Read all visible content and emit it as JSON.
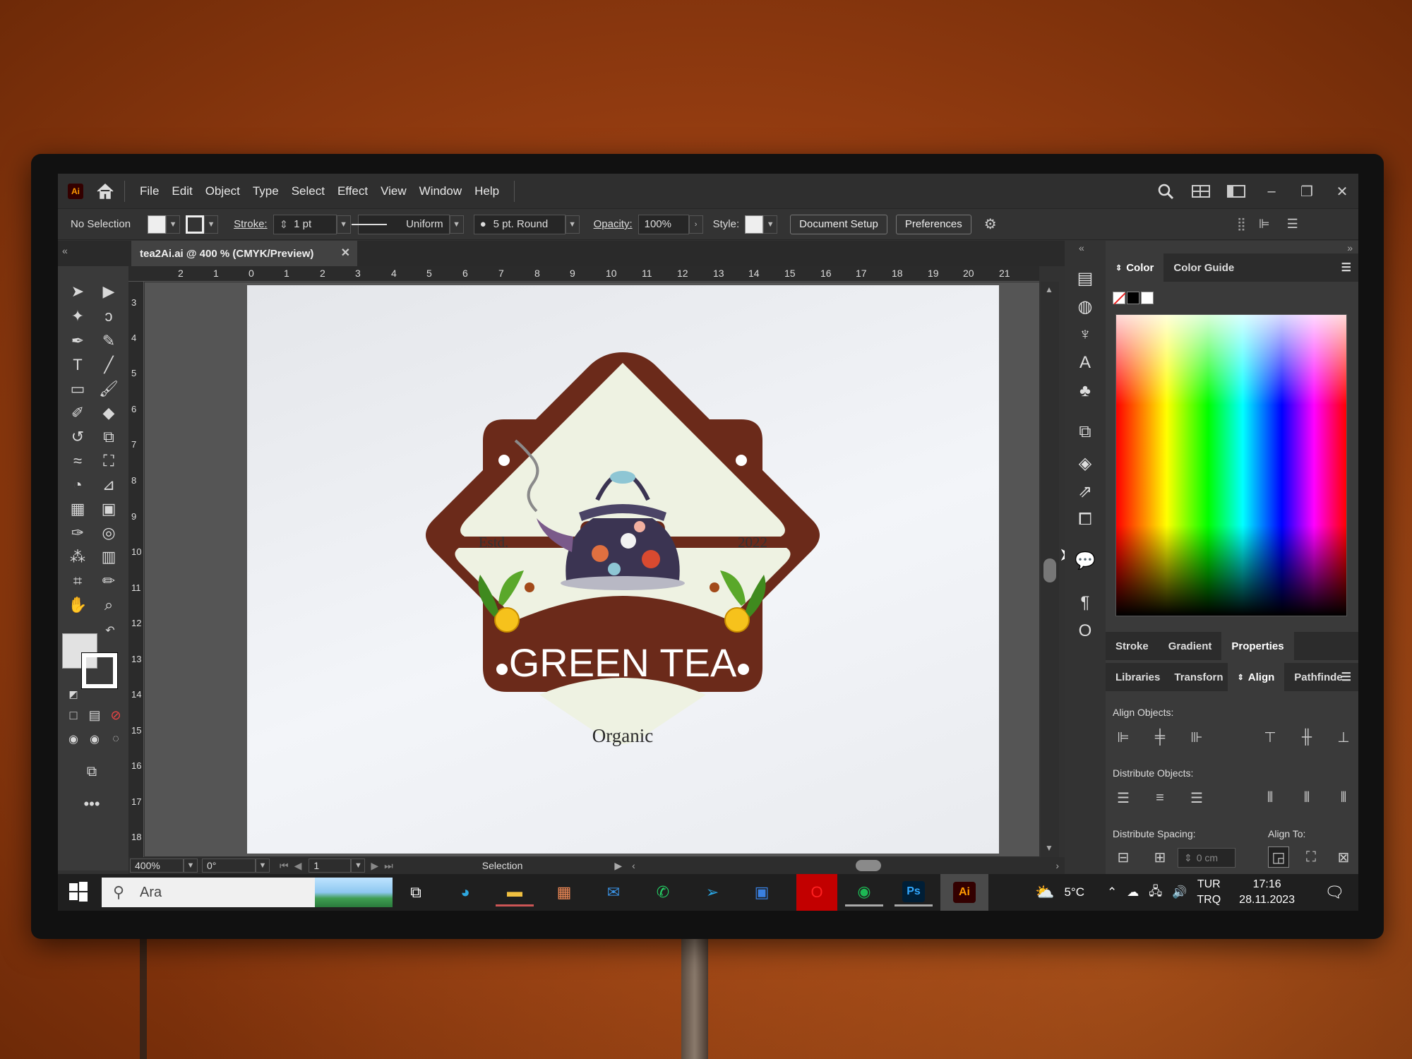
{
  "menubar": {
    "logo": "Ai",
    "items": [
      "File",
      "Edit",
      "Object",
      "Type",
      "Select",
      "Effect",
      "View",
      "Window",
      "Help"
    ]
  },
  "controlbar": {
    "selection": "No Selection",
    "stroke_label": "Stroke:",
    "stroke_weight": "1 pt",
    "profile": "Uniform",
    "brush": "5 pt. Round",
    "opacity_label": "Opacity:",
    "opacity": "100%",
    "style_label": "Style:",
    "document_setup": "Document Setup",
    "preferences": "Preferences"
  },
  "document": {
    "tab_title": "tea2Ai.ai @ 400 % (CMYK/Preview)",
    "ruler_top": [
      "2",
      "1",
      "0",
      "1",
      "2",
      "3",
      "4",
      "5",
      "6",
      "7",
      "8",
      "9",
      "10",
      "11",
      "12",
      "13",
      "14",
      "15",
      "16",
      "17",
      "18",
      "19",
      "20",
      "21"
    ],
    "ruler_left": [
      "3",
      "4",
      "5",
      "6",
      "7",
      "8",
      "9",
      "10",
      "11",
      "12",
      "13",
      "14",
      "15",
      "16",
      "17",
      "18"
    ]
  },
  "artwork": {
    "left_text": "Estd.",
    "right_text": "2022",
    "title": "GREEN TEA",
    "subtitle": "Organic",
    "badge_color": "#6b2a1a",
    "cream_color": "#eef2e2"
  },
  "statusbar": {
    "zoom": "400%",
    "rotation": "0°",
    "artboard_num": "1",
    "tool": "Selection"
  },
  "panels": {
    "color_tabs": [
      "Color",
      "Color Guide"
    ],
    "mid_tabs": [
      "Stroke",
      "Gradient",
      "Properties"
    ],
    "align_tabs": [
      "Libraries",
      "Transforn",
      "Align",
      "Pathfinde"
    ],
    "align_objects": "Align Objects:",
    "distribute_objects": "Distribute Objects:",
    "distribute_spacing": "Distribute Spacing:",
    "align_to": "Align To:",
    "spacing_value": "0 cm"
  },
  "taskbar": {
    "search_placeholder": "Ara",
    "weather": "5°C",
    "lang_top": "TUR",
    "lang_bottom": "TRQ",
    "time": "17:16",
    "date": "28.11.2023",
    "apps": [
      "task-view",
      "edge",
      "file-explorer",
      "store",
      "mail",
      "whatsapp",
      "telegram",
      "remote-desktop",
      "opera",
      "spotify",
      "photoshop",
      "illustrator"
    ]
  }
}
